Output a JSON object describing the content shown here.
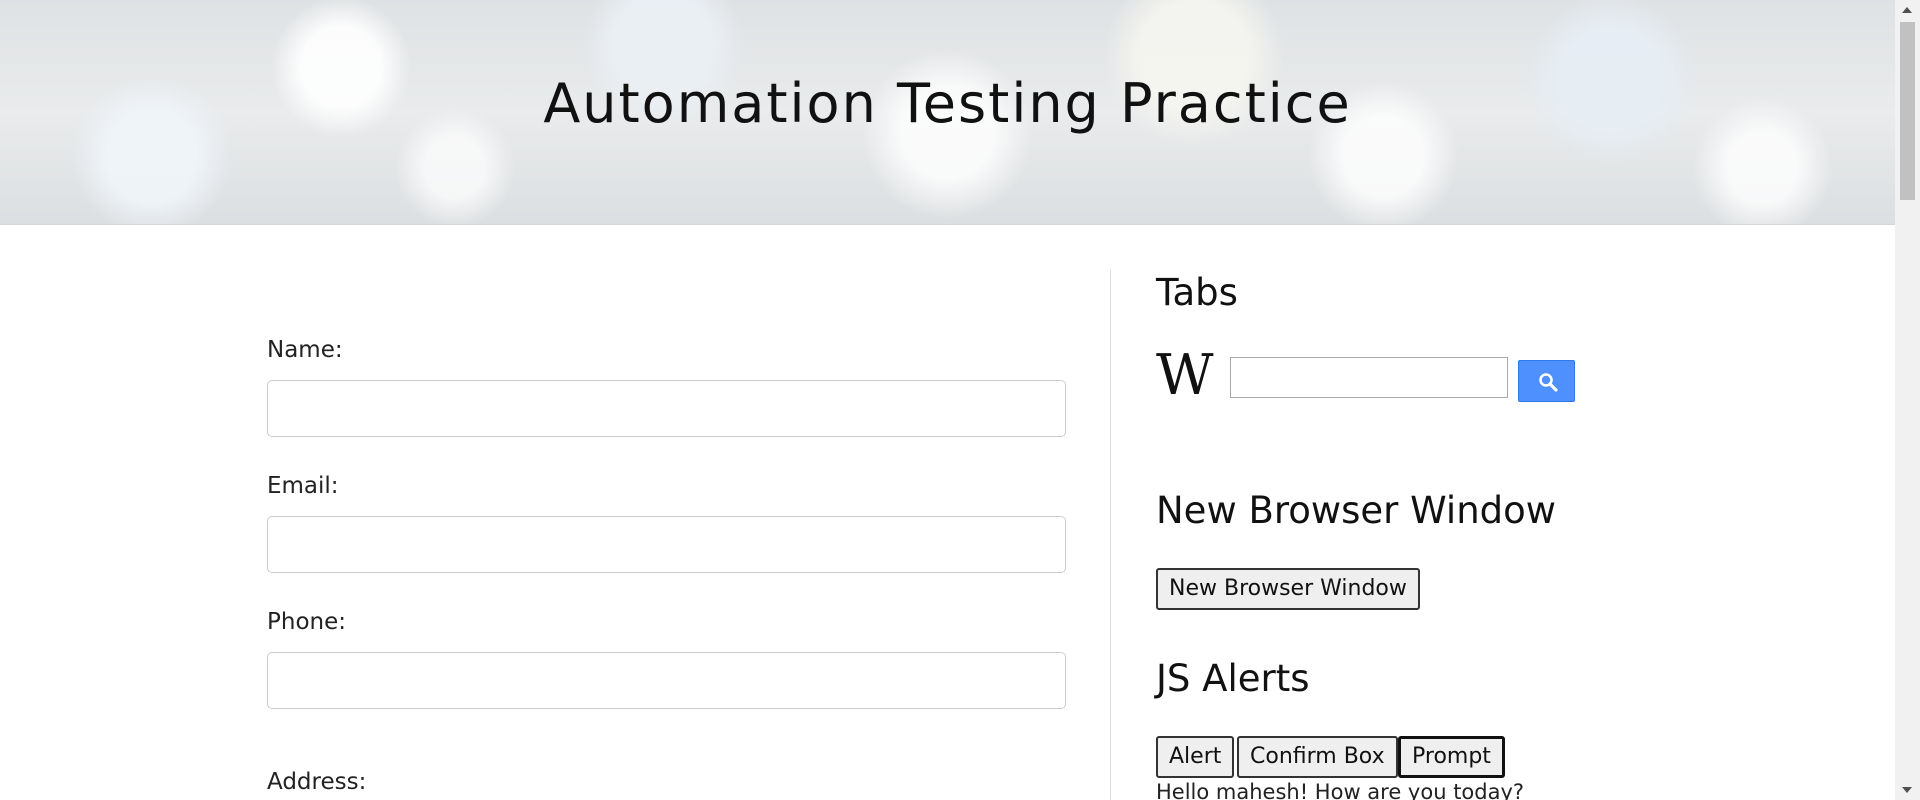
{
  "header": {
    "title": "Automation Testing Practice"
  },
  "form": {
    "name_label": "Name:",
    "email_label": "Email:",
    "phone_label": "Phone:",
    "address_label": "Address:",
    "name_value": "",
    "email_value": "",
    "phone_value": ""
  },
  "tabs_section": {
    "title": "Tabs",
    "wiki_logo": "W",
    "search_value": "",
    "search_icon": "search-icon",
    "search_button_color": "#4d90fe"
  },
  "browser_section": {
    "title": "New Browser Window",
    "button_label": "New Browser Window"
  },
  "alerts_section": {
    "title": "JS Alerts",
    "alert_label": "Alert",
    "confirm_label": "Confirm Box",
    "prompt_label": "Prompt",
    "result_text": "Hello mahesh! How are you today?"
  }
}
